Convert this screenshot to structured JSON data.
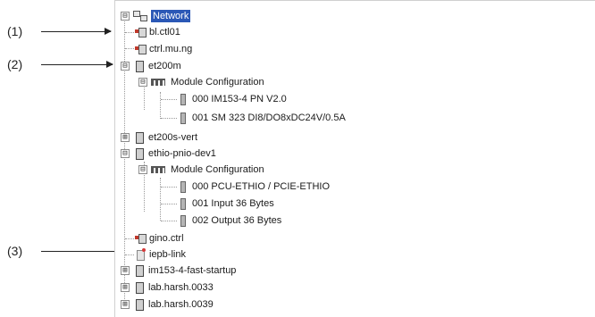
{
  "callouts": [
    {
      "label": "(1)"
    },
    {
      "label": "(2)"
    },
    {
      "label": "(3)"
    }
  ],
  "tree": {
    "root": {
      "label": "Network",
      "expander": "⊟",
      "icon": "network-icon"
    },
    "items": [
      {
        "label": "bl.ctl01",
        "icon": "controller-icon"
      },
      {
        "label": "ctrl.mu.ng",
        "icon": "controller-icon"
      },
      {
        "label": "et200m",
        "icon": "io-device-icon",
        "expander": "⊟"
      },
      {
        "label": "Module Configuration",
        "icon": "module-config-icon",
        "expander": "⊟"
      },
      {
        "label": "000 IM153-4 PN V2.0",
        "icon": "slot-module-icon"
      },
      {
        "label": "001 SM 323 DI8/DO8xDC24V/0.5A",
        "icon": "slot-module-icon"
      },
      {
        "label": "et200s-vert",
        "icon": "io-device-icon",
        "expander": "⊞"
      },
      {
        "label": "ethio-pnio-dev1",
        "icon": "io-device-icon",
        "expander": "⊟"
      },
      {
        "label": "Module Configuration",
        "icon": "module-config-icon",
        "expander": "⊟"
      },
      {
        "label": "000 PCU-ETHIO / PCIE-ETHIO",
        "icon": "slot-module-icon"
      },
      {
        "label": "001 Input 36 Bytes",
        "icon": "slot-module-icon"
      },
      {
        "label": "002 Output 36 Bytes",
        "icon": "slot-module-icon"
      },
      {
        "label": "gino.ctrl",
        "icon": "controller-icon"
      },
      {
        "label": "iepb-link",
        "icon": "link-device-icon"
      },
      {
        "label": "im153-4-fast-startup",
        "icon": "io-device-icon",
        "expander": "⊞"
      },
      {
        "label": "lab.harsh.0033",
        "icon": "io-device-icon",
        "expander": "⊞"
      },
      {
        "label": "lab.harsh.0039",
        "icon": "io-device-icon",
        "expander": "⊞"
      }
    ]
  }
}
